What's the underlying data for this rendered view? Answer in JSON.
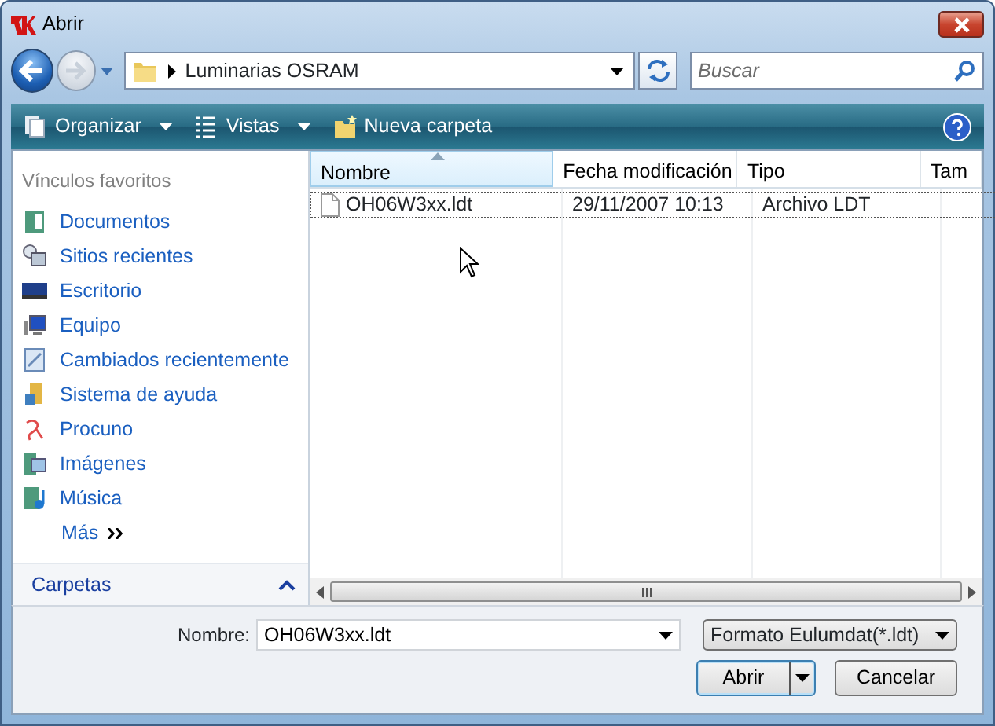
{
  "window": {
    "title": "Abrir"
  },
  "address_bar": {
    "path": "Luminarias OSRAM"
  },
  "search": {
    "placeholder": "Buscar"
  },
  "toolbar": [
    {
      "label": "Organizar",
      "dropdown": true
    },
    {
      "label": "Vistas",
      "dropdown": true
    },
    {
      "label": "Nueva carpeta",
      "dropdown": false
    }
  ],
  "sidebar": {
    "heading": "Vínculos favoritos",
    "items": [
      {
        "label": "Documentos"
      },
      {
        "label": "Sitios recientes"
      },
      {
        "label": "Escritorio"
      },
      {
        "label": "Equipo"
      },
      {
        "label": "Cambiados recientemente"
      },
      {
        "label": "Sistema de ayuda"
      },
      {
        "label": "Procuno"
      },
      {
        "label": "Imágenes"
      },
      {
        "label": "Música"
      }
    ],
    "more": "Más",
    "folders_label": "Carpetas",
    "folders_expanded": false
  },
  "file_list": {
    "columns": [
      {
        "label": "Nombre",
        "sorted": true
      },
      {
        "label": "Fecha modificación",
        "sorted": false
      },
      {
        "label": "Tipo",
        "sorted": false
      },
      {
        "label": "Tam",
        "sorted": false
      }
    ],
    "rows": [
      {
        "cells": [
          "OH06W3xx.ldt",
          "29/11/2007 10:13",
          "Archivo LDT"
        ],
        "selected": true
      }
    ]
  },
  "footer": {
    "name_label": "Nombre:",
    "name_value": "OH06W3xx.ldt",
    "file_type": "Formato Eulumdat(*.ldt)",
    "buttons": [
      {
        "label": "Abrir",
        "kind": "split"
      },
      {
        "label": "Cancelar",
        "kind": "plain"
      }
    ]
  }
}
